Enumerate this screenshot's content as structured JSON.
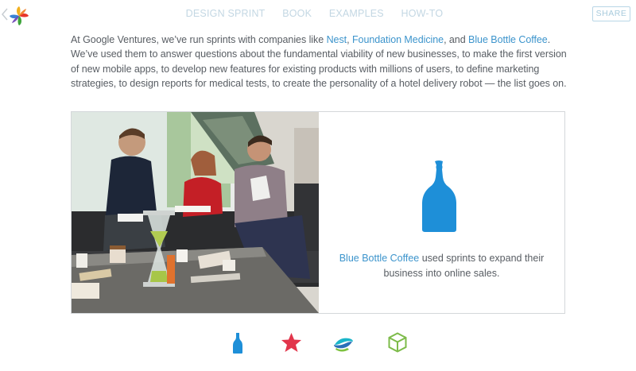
{
  "nav": {
    "items": [
      {
        "label": "DESIGN SPRINT"
      },
      {
        "label": "BOOK"
      },
      {
        "label": "EXAMPLES"
      },
      {
        "label": "HOW-TO"
      }
    ],
    "share_label": "SHARE"
  },
  "intro": {
    "part1": "At Google Ventures, we’ve run sprints with companies like ",
    "link_nest": "Nest",
    "sep1": ", ",
    "link_foundation": "Foundation Medicine",
    "sep2": ", and ",
    "link_bluebottle": "Blue Bottle Coffee",
    "part2": ". We’ve used them to answer questions about the fundamental viability of new businesses, to make the first version of new mobile apps, to develop new features for existing products with millions of users, to define marketing strategies, to design reports for medical tests, to create the personality of a hotel delivery robot — the list goes on."
  },
  "feature": {
    "link_text": "Blue Bottle Coffee",
    "caption_text": " used sprints to expand their business into online sales."
  },
  "icons": {
    "back": "chevron-left-icon",
    "logo": "gv-sprint-logo",
    "bottle": "blue-bottle-icon",
    "star": "star-icon",
    "helix": "foundation-medicine-icon",
    "cube": "cube-icon"
  },
  "colors": {
    "link": "#3c94cc",
    "nav": "#c3d7e3",
    "bottle_blue": "#1e8fd8",
    "star_red": "#e2354b",
    "cube_green": "#7dbb4a"
  }
}
